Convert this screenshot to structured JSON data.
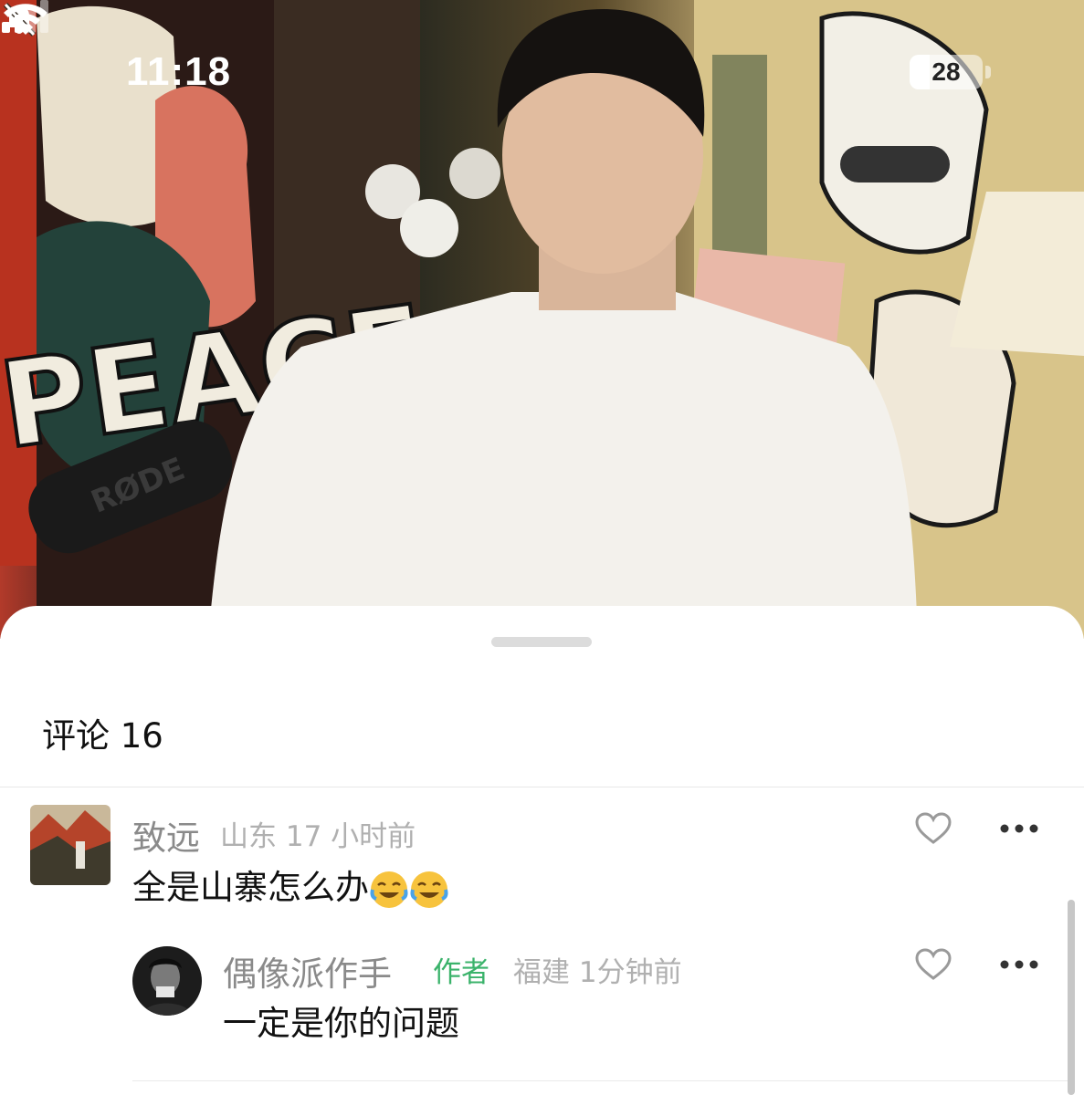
{
  "status_bar": {
    "time": "11:18",
    "battery_level": "28",
    "battery_fraction": 0.28,
    "icons": [
      "bell-slash-icon",
      "cellular-signal-icon",
      "wifi-icon",
      "battery-icon"
    ]
  },
  "video_overlay_texts": {
    "wall_text": "PEACE",
    "mic_brand": "RØDE"
  },
  "comments": {
    "title": "评论 16",
    "items": [
      {
        "username": "致远",
        "location_time": "山东 17 小时前",
        "text": "全是山寨怎么办",
        "emojis": [
          "laughing-crying-emoji",
          "laughing-crying-emoji"
        ],
        "replies": [
          {
            "username": "偶像派作手",
            "badge": "作者",
            "location_time": "福建 1分钟前",
            "text": "一定是你的问题"
          }
        ]
      }
    ]
  },
  "colors": {
    "author_badge": "#3bb36b",
    "meta_gray": "#b0b0b0",
    "username_gray": "#8a8a8a"
  }
}
